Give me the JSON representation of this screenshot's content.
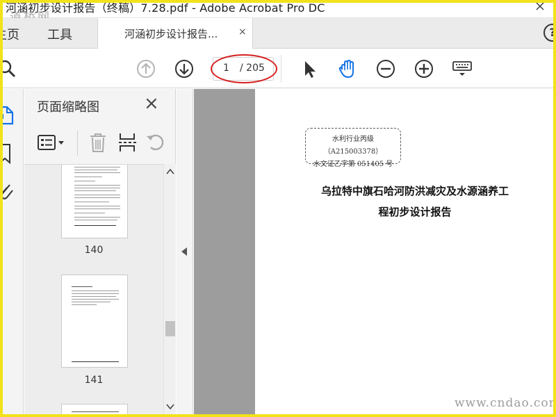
{
  "window": {
    "title": "河涵初步设计报告（终稿）7.28.pdf - Adobe Acrobat Pro DC",
    "watermark_top": "道桥网"
  },
  "tabs": {
    "home": "主页",
    "tools": "工具",
    "document": "河涵初步设计报告...",
    "close_glyph": "×"
  },
  "toolbar": {
    "page_current": "1",
    "page_total": "/ 205",
    "icons": [
      "search-icon",
      "prev-page-icon",
      "next-page-icon",
      "select-tool-icon",
      "hand-tool-icon",
      "zoom-out-icon",
      "zoom-in-icon",
      "keyboard-icon"
    ],
    "annotation_color": "#d81e1e",
    "hand_color": "#1473e6"
  },
  "panel": {
    "title": "页面缩略图",
    "close_glyph": "×",
    "thumbnails": [
      {
        "label": "140"
      },
      {
        "label": "141"
      }
    ]
  },
  "document": {
    "org_line1": "水利行业丙级（A215003378）",
    "org_line2": "水文证乙字第 051405 号",
    "title_line1": "乌拉特中旗石哈河防洪减灾及水源涵养工",
    "title_line2": "程初步设计报告"
  },
  "footer": {
    "watermark": "www.cndao.com"
  }
}
